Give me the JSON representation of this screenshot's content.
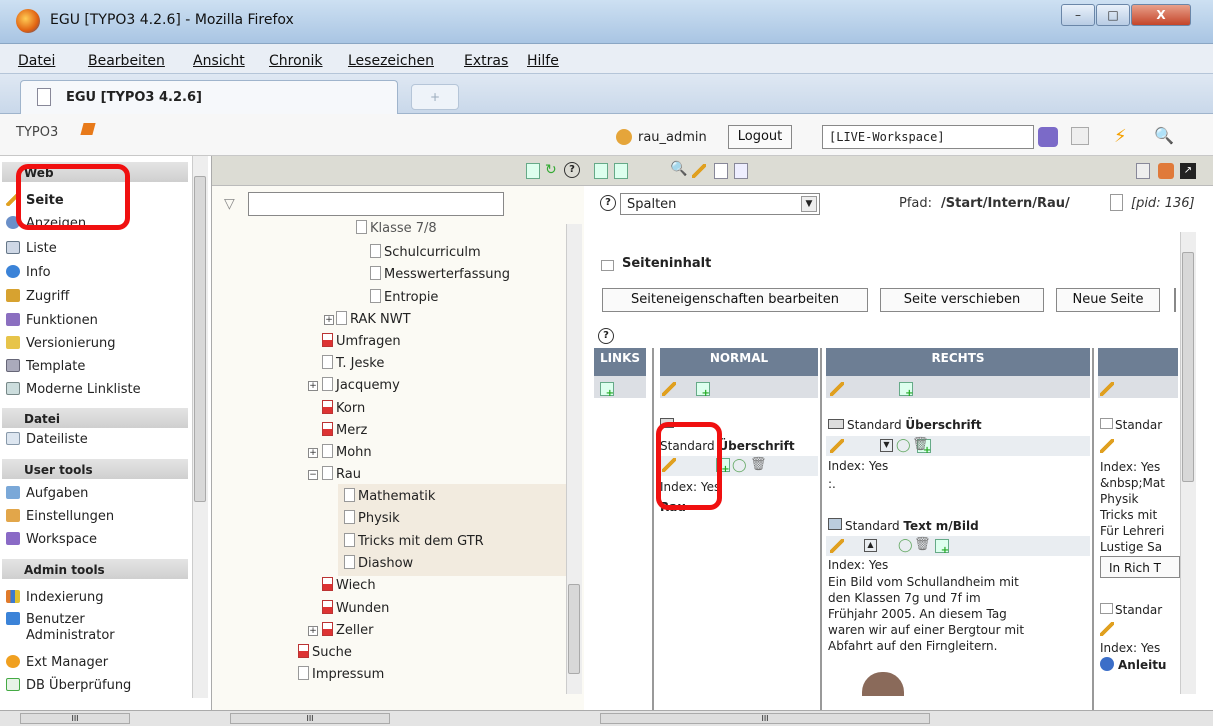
{
  "window": {
    "title": "EGU [TYPO3 4.2.6] - Mozilla Firefox",
    "minimize": "–",
    "maximize": "□",
    "close": "X"
  },
  "menubar": [
    "Datei",
    "Bearbeiten",
    "Ansicht",
    "Chronik",
    "Lesezeichen",
    "Extras",
    "Hilfe"
  ],
  "tab": {
    "label": "EGU [TYPO3 4.2.6]",
    "newtab": "+"
  },
  "header": {
    "logo": "TYPO3",
    "user": "rau_admin",
    "logout": "Logout",
    "workspace": "[LIVE-Workspace]"
  },
  "modules": {
    "web": "Web",
    "web_items": [
      "Seite",
      "Anzeigen",
      "Liste",
      "Info",
      "Zugriff",
      "Funktionen",
      "Versionierung",
      "Template",
      "Moderne Linkliste"
    ],
    "datei": "Datei",
    "datei_items": [
      "Dateiliste"
    ],
    "user": "User tools",
    "user_items": [
      "Aufgaben",
      "Einstellungen",
      "Workspace"
    ],
    "admin": "Admin tools",
    "admin_items": [
      "Indexierung",
      "Benutzer",
      "Administrator",
      "Ext Manager",
      "DB Überprüfung"
    ]
  },
  "tree": {
    "filter": "",
    "nodes": [
      "Klasse 7/8",
      "Schulcurriculm",
      "Messwerterfassung",
      "Entropie",
      "RAK NWT",
      "Umfragen",
      "T. Jeske",
      "Jacquemy",
      "Korn",
      "Merz",
      "Mohn",
      "Rau",
      "Mathematik",
      "Physik",
      "Tricks mit dem GTR",
      "Diashow",
      "Wiech",
      "Wunden",
      "Zeller",
      "Suche",
      "Impressum"
    ]
  },
  "main": {
    "view_select": "Spalten",
    "path_label": "Pfad:",
    "path": "/Start/Intern/Rau/",
    "pid": "[pid: 136]",
    "section": "Seiteninhalt",
    "buttons": [
      "Seiteneigenschaften bearbeiten",
      "Seite verschieben",
      "Neue Seite"
    ],
    "columns": [
      "LINKS",
      "NORMAL",
      "RECHTS"
    ],
    "normal": {
      "ce_type": "Standard",
      "ce_title": "Überschrift",
      "index": "Index: Yes",
      "text": "Rau"
    },
    "rechts": [
      {
        "type": "Standard",
        "title": "Überschrift",
        "index": "Index: Yes",
        "text": ":."
      },
      {
        "type": "Standard",
        "title": "Text m/Bild",
        "index": "Index: Yes",
        "lines": [
          "Ein Bild vom Schullandheim mit",
          "den Klassen 7g und 7f im",
          "Frühjahr 2005. An diesem Tag",
          "waren wir auf einer Bergtour mit",
          "Abfahrt auf den Firngleitern."
        ]
      }
    ],
    "right": {
      "type": "Standard",
      "index": "Index: Yes",
      "lines": [
        "&nbsp;Mat",
        "Physik",
        "Tricks mit",
        "Für Lehreri",
        "Lustige Sa"
      ],
      "btn": "In Rich T",
      "type2": "Standar",
      "index2": "Index: Yes",
      "anleit": "Anleitu"
    }
  },
  "statusbar": {
    "dots": "III"
  }
}
